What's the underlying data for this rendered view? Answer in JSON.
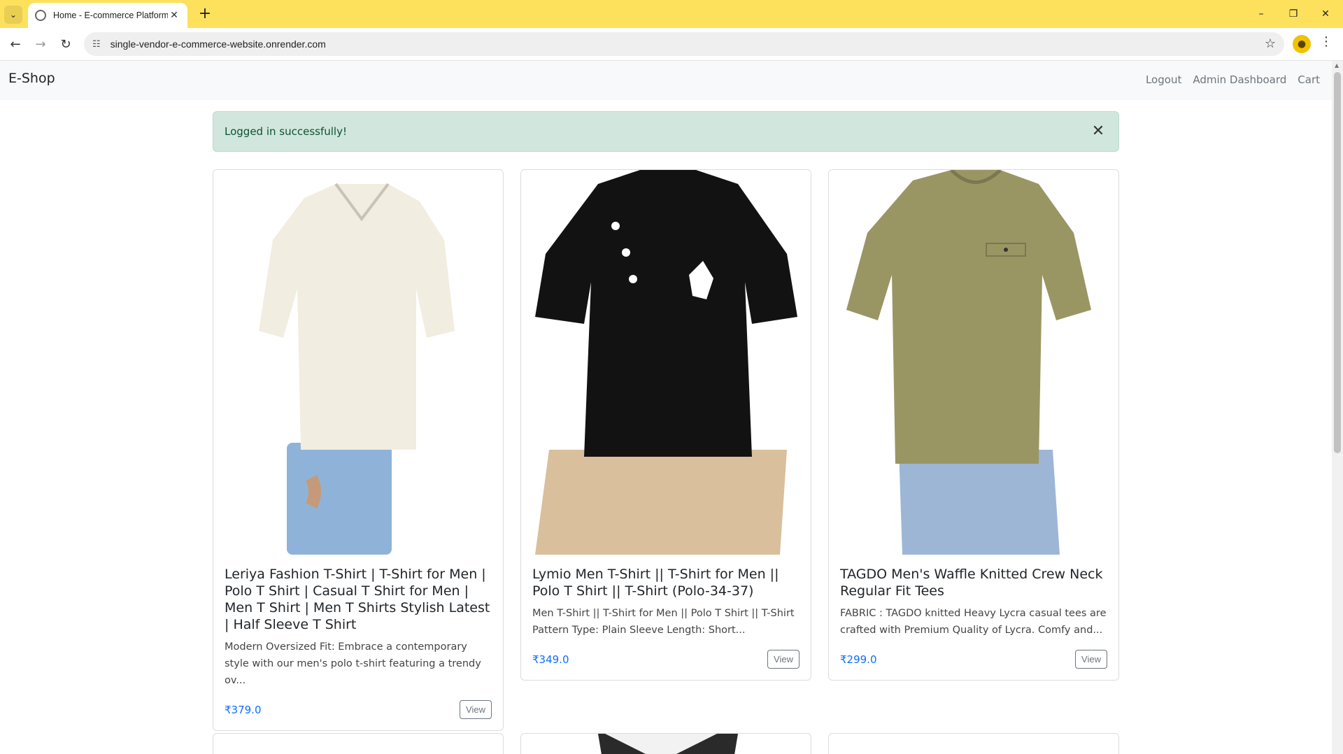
{
  "browser": {
    "tab_title": "Home - E-commerce Platform",
    "url": "single-vendor-e-commerce-website.onrender.com"
  },
  "site": {
    "brand": "E-Shop",
    "nav": [
      "Logout",
      "Admin Dashboard",
      "Cart"
    ]
  },
  "alert": {
    "message": "Logged in successfully!"
  },
  "products": [
    {
      "title": "Leriya Fashion T-Shirt | T-Shirt for Men | Polo T Shirt | Casual T Shirt for Men | Men T Shirt | Men T Shirts Stylish Latest | Half Sleeve T Shirt",
      "description": "Modern Oversized Fit: Embrace a contemporary style with our men's polo t-shirt featuring a trendy ov...",
      "price": "₹379.0",
      "button": "View",
      "shirt_color": "#f1ede0",
      "pant_color": "#8fb3d8"
    },
    {
      "title": "Lymio Men T-Shirt || T-Shirt for Men || Polo T Shirt || T-Shirt (Polo-34-37)",
      "description": "Men T-Shirt || T-Shirt for Men || Polo T Shirt || T-Shirt Pattern Type: Plain Sleeve Length: Short...",
      "price": "₹349.0",
      "button": "View",
      "shirt_color": "#121212",
      "pant_color": "#d9bf9c"
    },
    {
      "title": "TAGDO Men's Waffle Knitted Crew Neck Regular Fit Tees",
      "description": "FABRIC : TAGDO knitted Heavy Lycra casual tees are crafted with Premium Quality of Lycra. Comfy and...",
      "price": "₹299.0",
      "button": "View",
      "shirt_color": "#9a9664",
      "pant_color": "#9db6d6"
    }
  ]
}
